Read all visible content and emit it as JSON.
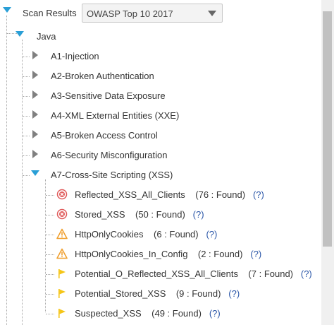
{
  "header": {
    "label": "Scan Results",
    "select_value": "OWASP Top 10 2017"
  },
  "tree": {
    "language": "Java",
    "categories": [
      {
        "label": "A1-Injection"
      },
      {
        "label": "A2-Broken Authentication"
      },
      {
        "label": "A3-Sensitive Data Exposure"
      },
      {
        "label": "A4-XML External Entities (XXE)"
      },
      {
        "label": "A5-Broken Access Control"
      },
      {
        "label": "A6-Security Misconfiguration"
      },
      {
        "label": "A7-Cross-Site Scripting (XSS)"
      }
    ],
    "results": [
      {
        "name": "Reflected_XSS_All_Clients",
        "count": "(76 : Found)",
        "help": "(?)",
        "severity": "high"
      },
      {
        "name": "Stored_XSS",
        "count": "(50 : Found)",
        "help": "(?)",
        "severity": "high"
      },
      {
        "name": "HttpOnlyCookies",
        "count": "(6 : Found)",
        "help": "(?)",
        "severity": "medium"
      },
      {
        "name": "HttpOnlyCookies_In_Config",
        "count": "(2 : Found)",
        "help": "(?)",
        "severity": "medium"
      },
      {
        "name": "Potential_O_Reflected_XSS_All_Clients",
        "count": "(7 : Found)",
        "help": "(?)",
        "severity": "low"
      },
      {
        "name": "Potential_Stored_XSS",
        "count": "(9 : Found)",
        "help": "(?)",
        "severity": "low"
      },
      {
        "name": "Suspected_XSS",
        "count": "(49 : Found)",
        "help": "(?)",
        "severity": "low"
      }
    ]
  },
  "colors": {
    "expand_arrow": "#2a9fd6",
    "collapsed_arrow": "#808080",
    "high": "#e05a5a",
    "medium": "#f0a030",
    "low": "#f5c518",
    "help_link": "#2a56a8"
  },
  "icons": {
    "high": "x-circle-icon",
    "medium": "warning-triangle-icon",
    "low": "flag-icon"
  }
}
